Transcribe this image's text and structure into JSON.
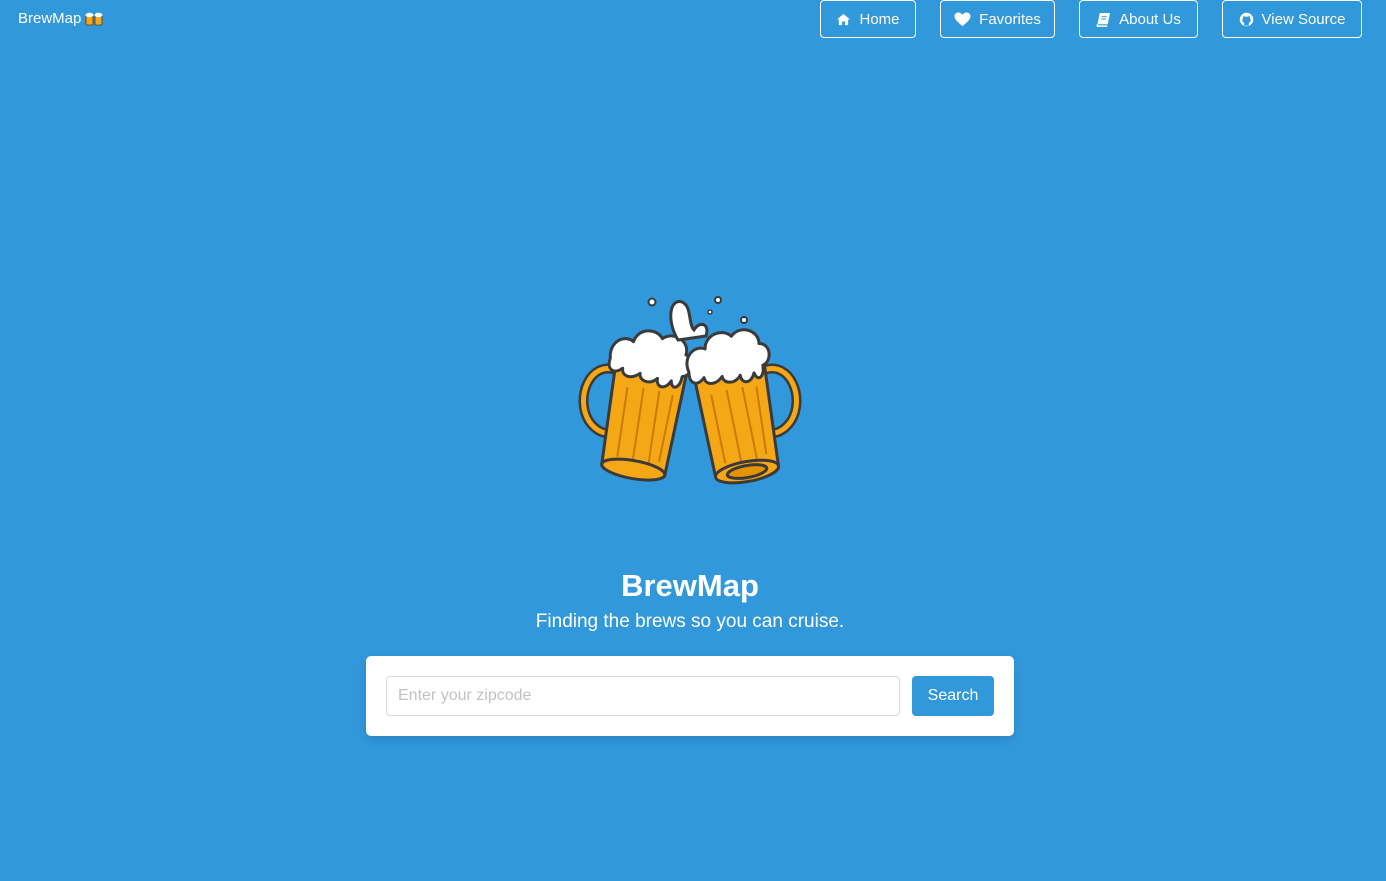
{
  "brand": {
    "name": "BrewMap",
    "icon": "beer-mugs-emoji"
  },
  "nav": {
    "items": [
      {
        "label": "Home",
        "icon": "home-icon"
      },
      {
        "label": "Favorites",
        "icon": "heart-icon"
      },
      {
        "label": "About Us",
        "icon": "book-icon"
      },
      {
        "label": "View Source",
        "icon": "github-icon"
      }
    ]
  },
  "hero": {
    "logo": "clinking-beer-mugs-illustration",
    "title": "BrewMap",
    "subtitle": "Finding the brews so you can cruise."
  },
  "search": {
    "placeholder": "Enter your zipcode",
    "value": "",
    "button_label": "Search"
  },
  "colors": {
    "background": "#3298dc",
    "primary": "#3298dc",
    "text_on_primary": "#ffffff",
    "beer": "#f5a716",
    "foam": "#ffffff",
    "outline": "#3a3a3a"
  }
}
